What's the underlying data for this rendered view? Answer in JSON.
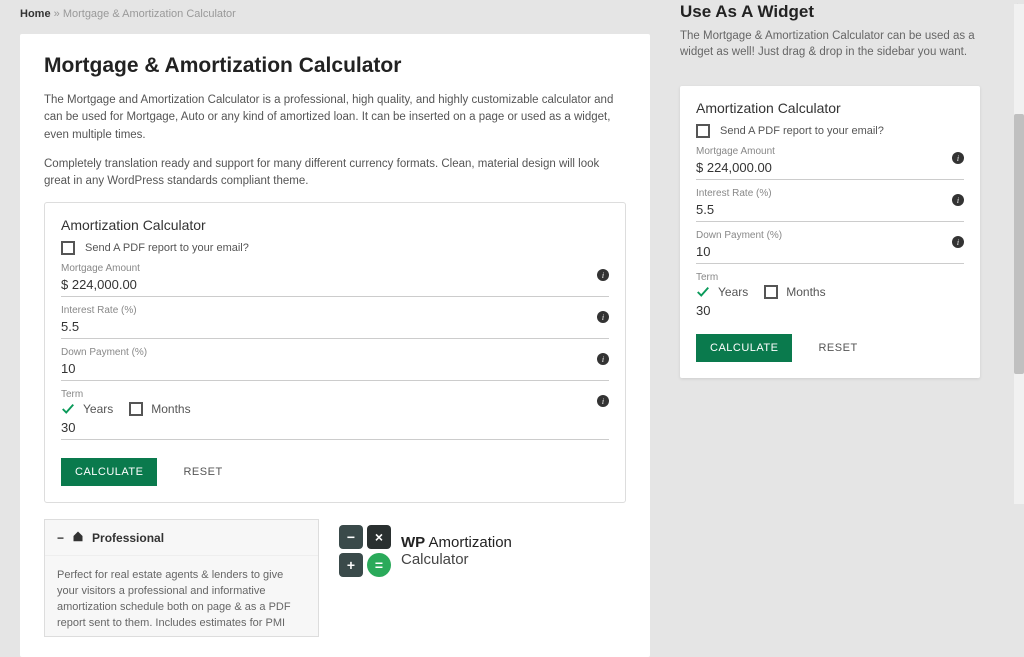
{
  "breadcrumb": {
    "home": "Home",
    "sep": "»",
    "current": "Mortgage & Amortization Calculator"
  },
  "main": {
    "title": "Mortgage & Amortization Calculator",
    "p1": "The Mortgage and Amortization Calculator is a professional, high quality, and highly customizable calculator and can be used for Mortgage, Auto or any kind of amortized loan.  It can be inserted on a page or used as a widget, even multiple times.",
    "p2": "Completely translation ready and support for many different currency formats.  Clean, material design will look great in any WordPress standards compliant theme."
  },
  "calc": {
    "title": "Amortization Calculator",
    "pdf_label": "Send A PDF report to your email?",
    "fields": {
      "amount_label": "Mortgage Amount",
      "amount_value": "$ 224,000.00",
      "rate_label": "Interest Rate (%)",
      "rate_value": "5.5",
      "down_label": "Down Payment (%)",
      "down_value": "10",
      "term_label": "Term",
      "term_years": "Years",
      "term_months": "Months",
      "term_value": "30"
    },
    "calc_btn": "CALCULATE",
    "reset_btn": "RESET"
  },
  "accordion": {
    "title": "Professional",
    "body": "Perfect for real estate agents & lenders to give your visitors a professional and informative amortization schedule both on page & as a PDF report sent to them.  Includes estimates for PMI"
  },
  "logo": {
    "line1_bold": "WP",
    "line1_rest": " Amortization",
    "line2": "Calculator",
    "minus": "−",
    "times": "×",
    "plus": "+",
    "equals": "="
  },
  "sidebar": {
    "title": "Use As A Widget",
    "desc": "The Mortgage & Amortization Calculator can be used as a widget as well! Just drag & drop in the sidebar you want."
  }
}
